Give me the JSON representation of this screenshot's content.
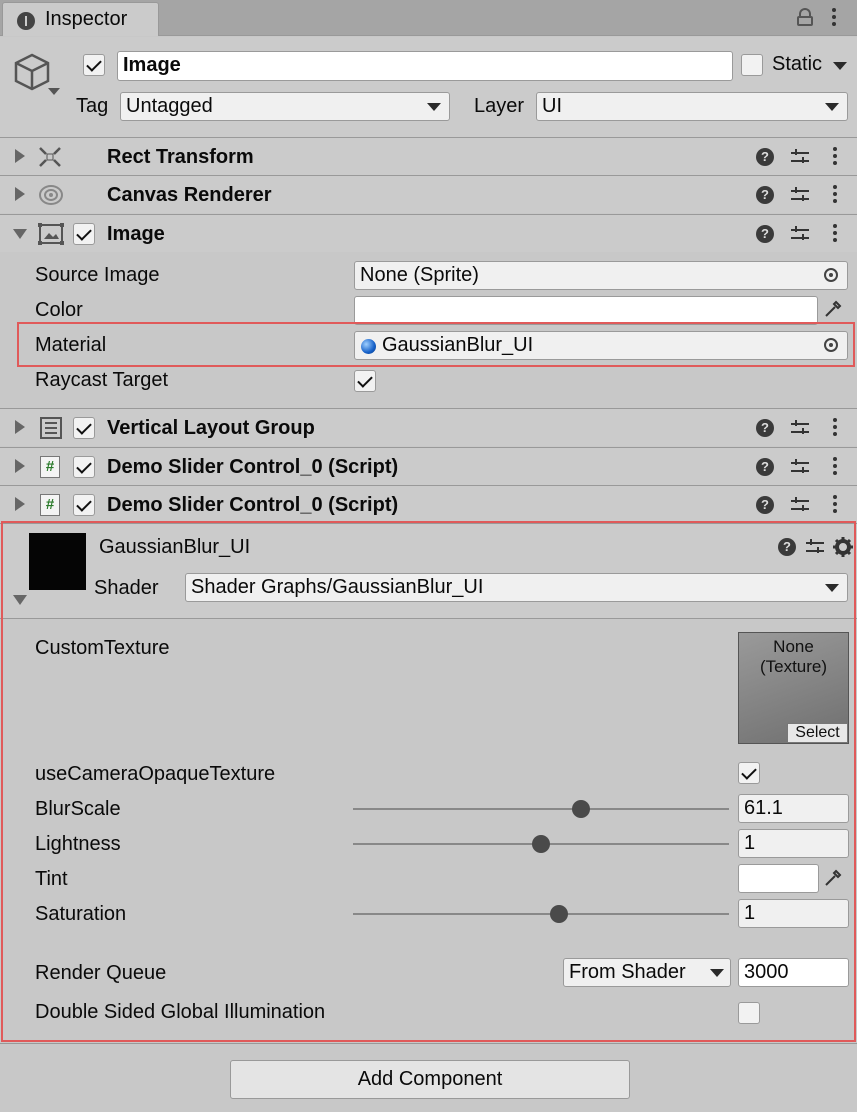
{
  "window": {
    "tab_title": "Inspector"
  },
  "gameobject": {
    "name": "Image",
    "active": true,
    "static_label": "Static",
    "static_checked": false,
    "tag_label": "Tag",
    "tag_value": "Untagged",
    "layer_label": "Layer",
    "layer_value": "UI"
  },
  "components": {
    "rect_transform": {
      "title": "Rect Transform"
    },
    "canvas_renderer": {
      "title": "Canvas Renderer"
    },
    "image": {
      "title": "Image",
      "enabled": true,
      "source_image_label": "Source Image",
      "source_image_value": "None (Sprite)",
      "color_label": "Color",
      "color_value": "#ffffff",
      "material_label": "Material",
      "material_value": "GaussianBlur_UI",
      "raycast_label": "Raycast Target",
      "raycast_checked": true
    },
    "vertical_layout_group": {
      "title": "Vertical Layout Group",
      "enabled": true
    },
    "script_1": {
      "title": "Demo Slider Control_0 (Script)",
      "enabled": true
    },
    "script_2": {
      "title": "Demo Slider Control_0 (Script)",
      "enabled": true
    }
  },
  "material": {
    "name": "GaussianBlur_UI",
    "shader_label": "Shader",
    "shader_value": "Shader Graphs/GaussianBlur_UI",
    "custom_texture_label": "CustomTexture",
    "texture_none_line1": "None",
    "texture_none_line2": "(Texture)",
    "texture_select": "Select",
    "use_camera_label": "useCameraOpaqueTexture",
    "use_camera_checked": true,
    "blur_label": "BlurScale",
    "blur_value": "61.1",
    "blur_fraction": 0.611,
    "lightness_label": "Lightness",
    "lightness_value": "1",
    "tint_label": "Tint",
    "tint_color": "#ffffff",
    "saturation_label": "Saturation",
    "saturation_value": "1",
    "render_queue_label": "Render Queue",
    "render_queue_mode": "From Shader",
    "render_queue_value": "3000",
    "double_sided_label": "Double Sided Global Illumination",
    "double_sided_checked": false
  },
  "footer": {
    "add_component_label": "Add Component"
  },
  "colors": {
    "highlight": "#e05a5a",
    "panel": "#c8c8c8",
    "header": "#cbcbcb"
  }
}
